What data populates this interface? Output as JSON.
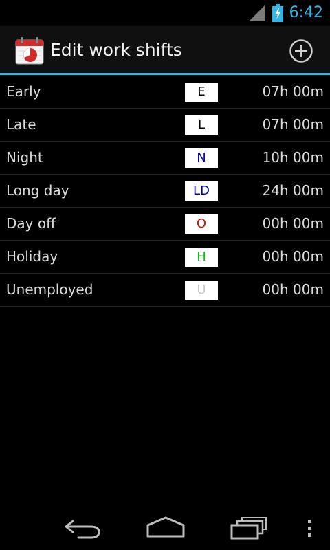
{
  "status_bar": {
    "time": "6:42",
    "signal_icon": "cell-signal-icon",
    "battery_icon": "battery-charging-icon",
    "time_color": "#33b5e5"
  },
  "action_bar": {
    "app_icon": "calendar-app-icon",
    "title": "Edit work shifts",
    "add_icon": "add-circle-icon",
    "accent_color": "#33b5e5"
  },
  "shifts": [
    {
      "name": "Early",
      "code": "E",
      "code_color": "#000000",
      "hours": "07h 00m"
    },
    {
      "name": "Late",
      "code": "L",
      "code_color": "#000000",
      "hours": "07h 00m"
    },
    {
      "name": "Night",
      "code": "N",
      "code_color": "#0000b0",
      "hours": "10h 00m"
    },
    {
      "name": "Long day",
      "code": "LD",
      "code_color": "#0000b0",
      "hours": "24h 00m"
    },
    {
      "name": "Day off",
      "code": "O",
      "code_color": "#d01010",
      "hours": "00h 00m"
    },
    {
      "name": "Holiday",
      "code": "H",
      "code_color": "#10c010",
      "hours": "00h 00m"
    },
    {
      "name": "Unemployed",
      "code": "U",
      "code_color": "#c8c8c8",
      "hours": "00h 00m"
    }
  ],
  "nav_bar": {
    "back_icon": "back-icon",
    "home_icon": "home-icon",
    "recent_icon": "recent-apps-icon",
    "menu_icon": "overflow-menu-icon"
  }
}
